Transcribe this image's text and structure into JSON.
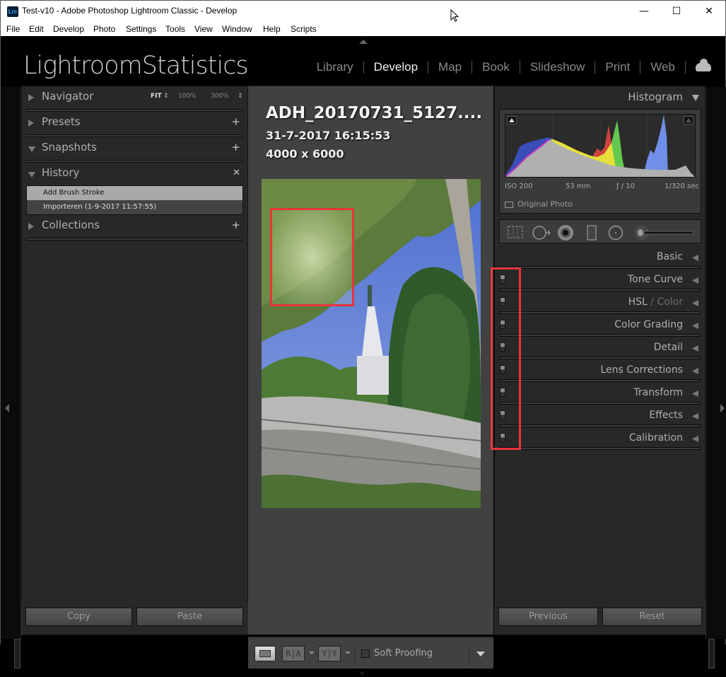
{
  "window": {
    "app_icon": "Lrc",
    "title": "Test-v10 - Adobe Photoshop Lightroom Classic - Develop",
    "controls": {
      "minimize": "—",
      "maximize": "☐",
      "close": "✕"
    }
  },
  "menu": [
    "File",
    "Edit",
    "Develop",
    "Photo",
    "Settings",
    "Tools",
    "View",
    "Window",
    "Help",
    "Scripts"
  ],
  "identity_plate": "LightroomStatistics",
  "modules": [
    {
      "label": "Library",
      "active": false
    },
    {
      "label": "Develop",
      "active": true
    },
    {
      "label": "Map",
      "active": false
    },
    {
      "label": "Book",
      "active": false
    },
    {
      "label": "Slideshow",
      "active": false
    },
    {
      "label": "Print",
      "active": false
    },
    {
      "label": "Web",
      "active": false
    }
  ],
  "left_panel": {
    "navigator": {
      "title": "Navigator",
      "zoom_options": [
        "FIT",
        "100%",
        "300%"
      ],
      "zoom_selected": "FIT"
    },
    "presets": {
      "title": "Presets",
      "action": "+"
    },
    "snapshots": {
      "title": "Snapshots",
      "action": "+"
    },
    "history": {
      "title": "History",
      "action": "✕",
      "items": [
        {
          "label": "Add Brush Stroke",
          "selected": true
        },
        {
          "label": "Importeren  (1-9-2017 11:57:55)",
          "selected": false
        }
      ]
    },
    "collections": {
      "title": "Collections",
      "action": "+"
    },
    "copy_label": "Copy",
    "paste_label": "Paste"
  },
  "photo_info": {
    "file_name": "ADH_20170731_5127....",
    "date": "31-7-2017 16:15:53",
    "dimensions": "4000 x 6000"
  },
  "toolbar": {
    "view_mode": "loupe",
    "before_after_label": "R|A",
    "before_after_yy_label": "Y|Y",
    "soft_proofing_label": "Soft Proofing",
    "soft_proofing_checked": false
  },
  "right_panel": {
    "histogram": {
      "title": "Histogram",
      "exif": {
        "iso": "ISO 200",
        "focal_length": "53 mm",
        "aperture": "ƒ / 10",
        "shutter": "1/320 sec"
      },
      "original_photo_label": "Original Photo",
      "original_photo_checked": false
    },
    "tools": [
      "crop-overlay",
      "spot-removal",
      "red-eye",
      "graduated-filter",
      "radial-filter",
      "adjustment-brush"
    ],
    "sections": [
      {
        "title": "Basic",
        "has_switch": false
      },
      {
        "title": "Tone Curve",
        "has_switch": true
      },
      {
        "title": "HSL",
        "title_suffix": " / Color",
        "has_switch": true
      },
      {
        "title": "Color Grading",
        "has_switch": true
      },
      {
        "title": "Detail",
        "has_switch": true
      },
      {
        "title": "Lens Corrections",
        "has_switch": true
      },
      {
        "title": "Transform",
        "has_switch": true
      },
      {
        "title": "Effects",
        "has_switch": true
      },
      {
        "title": "Calibration",
        "has_switch": true
      }
    ],
    "previous_label": "Previous",
    "reset_label": "Reset"
  },
  "annotations": {
    "highlight_color": "#e8353a"
  }
}
